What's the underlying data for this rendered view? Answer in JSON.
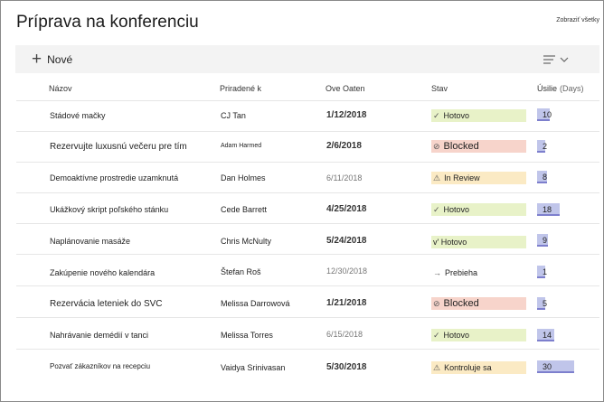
{
  "title": "Príprava na konferenciu",
  "show_all": "Zobraziť všetky",
  "toolbar": {
    "new_label": "Nové",
    "view_icon": "view-options-icon"
  },
  "columns": {
    "name": "Názov",
    "assigned": "Priradené k",
    "due": "Ove Oaten",
    "status": "Stav",
    "effort": "Úsilie",
    "effort_unit": "(Days)"
  },
  "effort_max": 30,
  "rows": [
    {
      "name": "Stádové mačky",
      "assigned": "CJ Tan",
      "due": "1/12/2018",
      "status": "Hotovo",
      "status_type": "done",
      "effort": "10"
    },
    {
      "name": "Rezervujte luxusnú večeru pre tím",
      "assigned": "Adam Harmed",
      "due": "2/6/2018",
      "status": "Blocked",
      "status_type": "blocked",
      "effort": "2"
    },
    {
      "name": "Demoaktívne prostredie uzamknutá",
      "assigned": "Dan Holmes",
      "due": "6/11/2018",
      "status": "In Review",
      "status_type": "review",
      "effort": "8"
    },
    {
      "name": "Ukážkový skript poľského stánku",
      "assigned": "Cede Barrett",
      "due": "4/25/2018",
      "status": "Hotovo",
      "status_type": "done",
      "effort": "18"
    },
    {
      "name": "Naplánovanie masáže",
      "assigned": "Chris McNulty",
      "due": "5/24/2018",
      "status": "v' Hotovo",
      "status_type": "done",
      "effort": "9"
    },
    {
      "name": "Zakúpenie nového kalendára",
      "assigned": "Štefan Roš",
      "due": "12/30/2018",
      "status": "Prebieha",
      "status_type": "progress",
      "effort": "1"
    },
    {
      "name": "Rezervácia leteniek do SVC",
      "assigned": "Melissa Darrowová",
      "due": "1/21/2018",
      "status": "Blocked",
      "status_type": "blocked",
      "effort": "5"
    },
    {
      "name": "Nahrávanie demédií v tanci",
      "assigned": "Melissa Torres",
      "due": "6/15/2018",
      "status": "Hotovo",
      "status_type": "done",
      "effort": "14"
    },
    {
      "name": "Pozvať zákazníkov na recepciu",
      "assigned": "Vaidya Srinivasan",
      "due": "5/30/2018",
      "status": "Kontroluje sa",
      "status_type": "review",
      "effort": "30"
    }
  ]
}
